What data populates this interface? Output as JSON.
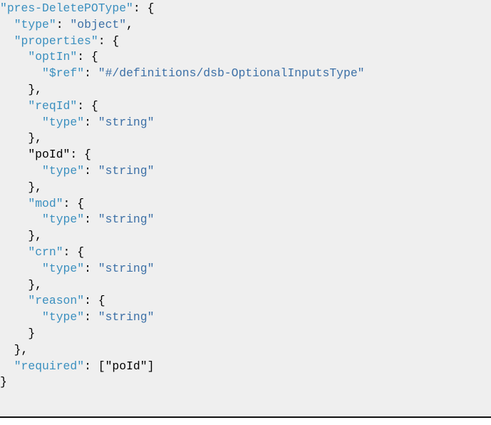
{
  "document": {
    "background": "#efefef",
    "key_color": "#3a8fbf",
    "string_color": "#3b6fa6",
    "lines": [
      [
        {
          "t": "\"pres-DeletePOType\"",
          "c": "key"
        },
        {
          "t": ": {",
          "c": "punc"
        }
      ],
      [
        {
          "t": "  ",
          "c": "ind"
        },
        {
          "t": "\"type\"",
          "c": "key"
        },
        {
          "t": ": ",
          "c": "punc"
        },
        {
          "t": "\"object\"",
          "c": "str"
        },
        {
          "t": ",",
          "c": "punc"
        }
      ],
      [
        {
          "t": "  ",
          "c": "ind"
        },
        {
          "t": "\"properties\"",
          "c": "key"
        },
        {
          "t": ": {",
          "c": "punc"
        }
      ],
      [
        {
          "t": "    ",
          "c": "ind"
        },
        {
          "t": "\"optIn\"",
          "c": "key"
        },
        {
          "t": ": {",
          "c": "punc"
        }
      ],
      [
        {
          "t": "      ",
          "c": "ind"
        },
        {
          "t": "\"$ref\"",
          "c": "key"
        },
        {
          "t": ": ",
          "c": "punc"
        },
        {
          "t": "\"#/definitions/dsb-OptionalInputsType\"",
          "c": "str"
        }
      ],
      [
        {
          "t": "    },",
          "c": "punc"
        }
      ],
      [
        {
          "t": "    ",
          "c": "ind"
        },
        {
          "t": "\"reqId\"",
          "c": "key"
        },
        {
          "t": ": {",
          "c": "punc"
        }
      ],
      [
        {
          "t": "      ",
          "c": "ind"
        },
        {
          "t": "\"type\"",
          "c": "key"
        },
        {
          "t": ": ",
          "c": "punc"
        },
        {
          "t": "\"string\"",
          "c": "str"
        }
      ],
      [
        {
          "t": "    },",
          "c": "punc"
        }
      ],
      [
        {
          "t": "    \"poId\": {",
          "c": "punc"
        }
      ],
      [
        {
          "t": "      ",
          "c": "ind"
        },
        {
          "t": "\"type\"",
          "c": "key"
        },
        {
          "t": ": ",
          "c": "punc"
        },
        {
          "t": "\"string\"",
          "c": "str"
        }
      ],
      [
        {
          "t": "    },",
          "c": "punc"
        }
      ],
      [
        {
          "t": "    ",
          "c": "ind"
        },
        {
          "t": "\"mod\"",
          "c": "key"
        },
        {
          "t": ": {",
          "c": "punc"
        }
      ],
      [
        {
          "t": "      ",
          "c": "ind"
        },
        {
          "t": "\"type\"",
          "c": "key"
        },
        {
          "t": ": ",
          "c": "punc"
        },
        {
          "t": "\"string\"",
          "c": "str"
        }
      ],
      [
        {
          "t": "    },",
          "c": "punc"
        }
      ],
      [
        {
          "t": "    ",
          "c": "ind"
        },
        {
          "t": "\"crn\"",
          "c": "key"
        },
        {
          "t": ": {",
          "c": "punc"
        }
      ],
      [
        {
          "t": "      ",
          "c": "ind"
        },
        {
          "t": "\"type\"",
          "c": "key"
        },
        {
          "t": ": ",
          "c": "punc"
        },
        {
          "t": "\"string\"",
          "c": "str"
        }
      ],
      [
        {
          "t": "    },",
          "c": "punc"
        }
      ],
      [
        {
          "t": "    ",
          "c": "ind"
        },
        {
          "t": "\"reason\"",
          "c": "key"
        },
        {
          "t": ": {",
          "c": "punc"
        }
      ],
      [
        {
          "t": "      ",
          "c": "ind"
        },
        {
          "t": "\"type\"",
          "c": "key"
        },
        {
          "t": ": ",
          "c": "punc"
        },
        {
          "t": "\"string\"",
          "c": "str"
        }
      ],
      [
        {
          "t": "    }",
          "c": "punc"
        }
      ],
      [
        {
          "t": "  },",
          "c": "punc"
        }
      ],
      [
        {
          "t": "  ",
          "c": "ind"
        },
        {
          "t": "\"required\"",
          "c": "key"
        },
        {
          "t": ": [\"poId\"]",
          "c": "punc"
        }
      ],
      [
        {
          "t": "}",
          "c": "punc"
        }
      ]
    ]
  }
}
